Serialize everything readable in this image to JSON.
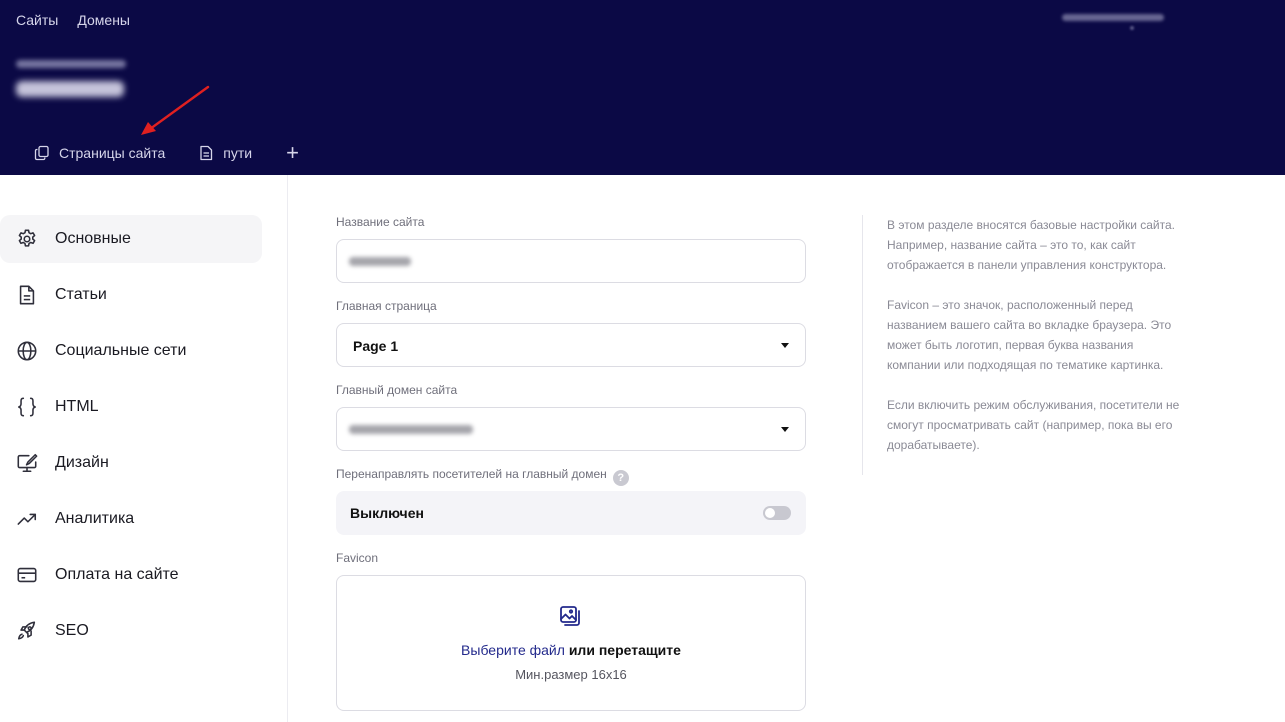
{
  "top_nav": {
    "sites": "Сайты",
    "domains": "Домены"
  },
  "site_tabs": [
    {
      "label": "Страницы сайта",
      "icon": "pages-icon"
    },
    {
      "label": "пути",
      "icon": "document-icon"
    }
  ],
  "add_tab_label": "+",
  "sidebar": {
    "items": [
      {
        "label": "Основные",
        "icon": "gear-icon"
      },
      {
        "label": "Статьи",
        "icon": "document-icon"
      },
      {
        "label": "Социальные сети",
        "icon": "globe-icon"
      },
      {
        "label": "HTML",
        "icon": "code-braces-icon"
      },
      {
        "label": "Дизайн",
        "icon": "monitor-brush-icon"
      },
      {
        "label": "Аналитика",
        "icon": "trend-up-icon"
      },
      {
        "label": "Оплата на сайте",
        "icon": "credit-card-icon"
      },
      {
        "label": "SEO",
        "icon": "rocket-icon"
      }
    ]
  },
  "form": {
    "site_name_label": "Название сайта",
    "main_page_label": "Главная страница",
    "main_page_value": "Page 1",
    "main_domain_label": "Главный домен сайта",
    "redirect_label": "Перенаправлять посетителей на главный домен",
    "redirect_help": "?",
    "redirect_state": "Выключен",
    "favicon_label": "Favicon",
    "favicon_choose": "Выберите файл",
    "favicon_or_drag": " или перетащите",
    "favicon_hint": "Мин.размер 16x16"
  },
  "info": {
    "p1": "В этом разделе вносятся базовые настройки сайта. Например, название сайта – это то, как сайт отображается в панели управления конструктора.",
    "p2": "Favicon – это значок, расположенный перед названием вашего сайта во вкладке браузера. Это может быть логотип, первая буква названия компании или подходящая по тематике картинка.",
    "p3": "Если включить режим обслуживания, посетители не смогут просматривать сайт (например, пока вы его дорабатываете)."
  },
  "colors": {
    "header_bg": "#0b0945",
    "accent": "#232a8c",
    "annotation_arrow": "#e02020"
  }
}
